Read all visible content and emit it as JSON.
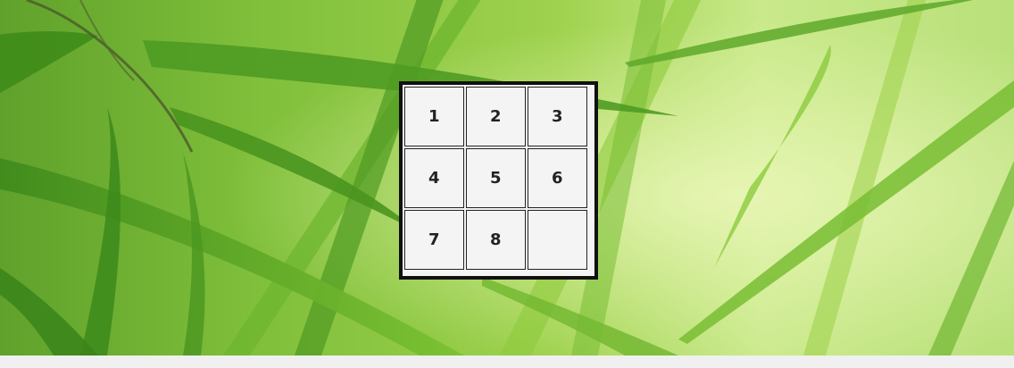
{
  "puzzle": {
    "tiles": [
      "1",
      "2",
      "3",
      "4",
      "5",
      "6",
      "7",
      "8",
      ""
    ]
  },
  "colors": {
    "board_border": "#111111",
    "tile_bg": "#f4f4f4",
    "tile_text": "#222222",
    "background_green": "#7fbf3a"
  }
}
